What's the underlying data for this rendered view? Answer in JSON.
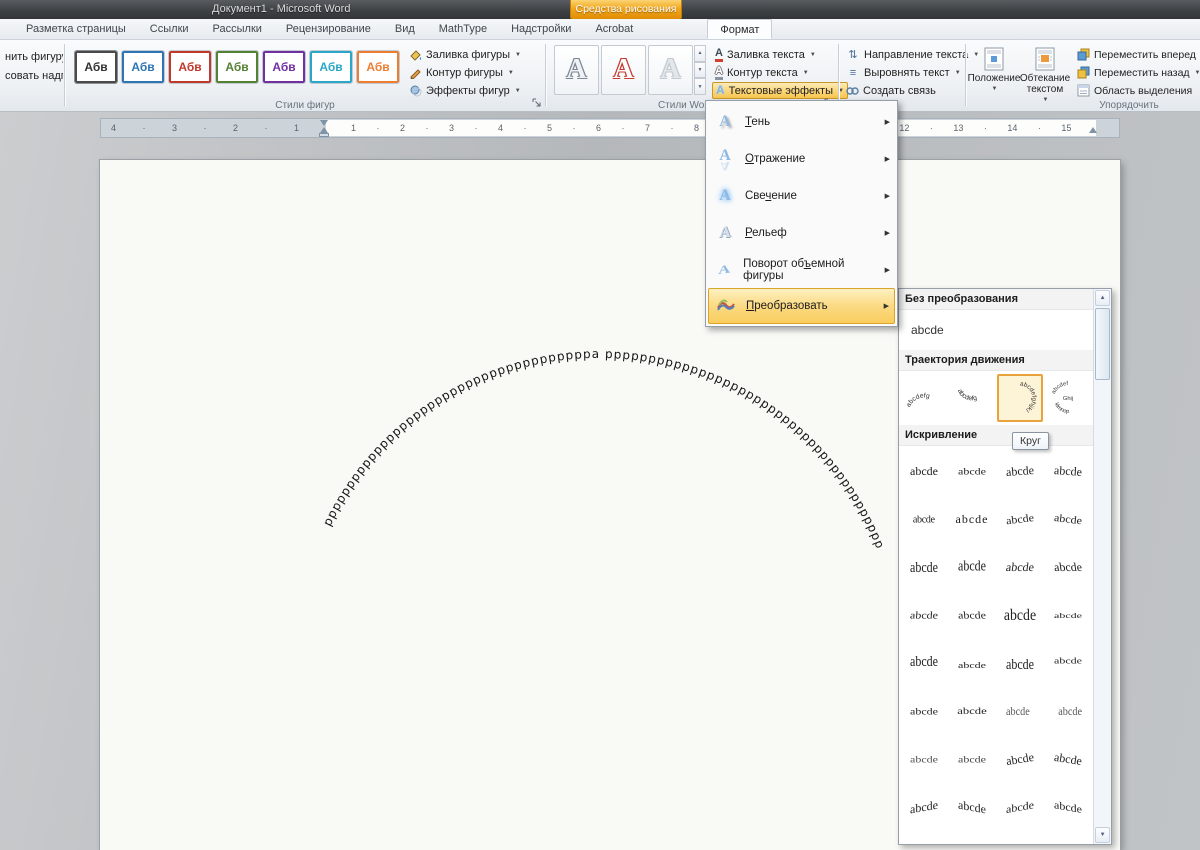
{
  "window": {
    "title": "Документ1  -  Microsoft Word",
    "contextual_tab_group": "Средства рисования"
  },
  "tabs": {
    "items": [
      "Разметка страницы",
      "Ссылки",
      "Рассылки",
      "Рецензирование",
      "Вид",
      "MathType",
      "Надстройки",
      "Acrobat"
    ],
    "active": "Формат"
  },
  "icons": {
    "dropdown_arrow": "▼",
    "submenu_arrow": "▶",
    "scroll_up": "▲",
    "scroll_down": "▼",
    "spinner_up": "▲",
    "spinner_down": "▼",
    "gallery_more": "▼"
  },
  "ribbon": {
    "insert_shapes": {
      "change_shape_label": "нить фигуру",
      "textbox_label": "совать надпись"
    },
    "shape_styles": {
      "group_label": "Стили фигур",
      "sample_text": "Абв",
      "swatch_colors": [
        "#4a4a4a",
        "#2e75b6",
        "#c0392b",
        "#548235",
        "#7030a0",
        "#2aa7c7",
        "#ed7d31"
      ],
      "fill_label": "Заливка фигуры",
      "outline_label": "Контур фигуры",
      "effects_label": "Эффекты фигур"
    },
    "wordart_styles": {
      "group_label": "Стили WordArt",
      "sample_letter": "A",
      "icon_letter": "A",
      "fill_label": "Заливка текста",
      "outline_label": "Контур текста",
      "effects_label": "Текстовые эффекты"
    },
    "text_group": {
      "direction_label": "Направление текста",
      "direction_glyph": "⇅",
      "align_label": "Выровнять текст",
      "align_glyph": "≡",
      "link_label": "Создать связь"
    },
    "arrange": {
      "group_label": "Упорядочить",
      "position_label": "Положение",
      "wrap_label": "Обтекание текстом",
      "forward_label": "Переместить вперед",
      "backward_label": "Переместить назад",
      "selection_label": "Область выделения"
    }
  },
  "ruler": {
    "left_numbers": "4 · 3 · 2 · 1",
    "right_numbers": "1 · 2 · 3 · 4 · 5 · 6 · 7 · 8 · 9 · 10 · 11 · 12 · 13 · 14 · 15"
  },
  "effects_menu": {
    "icon_letter": "A",
    "items": [
      {
        "pre": "",
        "key": "Т",
        "post": "ень"
      },
      {
        "pre": "",
        "key": "О",
        "post": "тражение"
      },
      {
        "pre": "Све",
        "key": "ч",
        "post": "ение"
      },
      {
        "pre": "",
        "key": "Р",
        "post": "ельеф"
      },
      {
        "pre": "Поворот об",
        "key": "ъ",
        "post": "емной фигуры"
      },
      {
        "pre": "",
        "key": "П",
        "post": "реобразовать"
      }
    ]
  },
  "transform_gallery": {
    "header_none": "Без преобразования",
    "none_tile_text": "abcde",
    "header_path": "Траектория движения",
    "path_text": "abcdefg",
    "circle_text": "abcdefghijkl",
    "button_top": "abcdef",
    "button_mid": "Ghij",
    "button_bot": "klmnop",
    "header_warp": "Искривление",
    "warp_text": "abcde",
    "tooltip": "Круг"
  },
  "document": {
    "wordart_text": "ppppppppppppppppppppppppppppppppppppppa pppppppppppppppppppppppppppppppppppppppppppppppppppppa"
  },
  "colors": {
    "contextual_tab": "#F0A30A",
    "highlight_fill": "#FBD77D",
    "selection_border": "#E8A33D"
  }
}
